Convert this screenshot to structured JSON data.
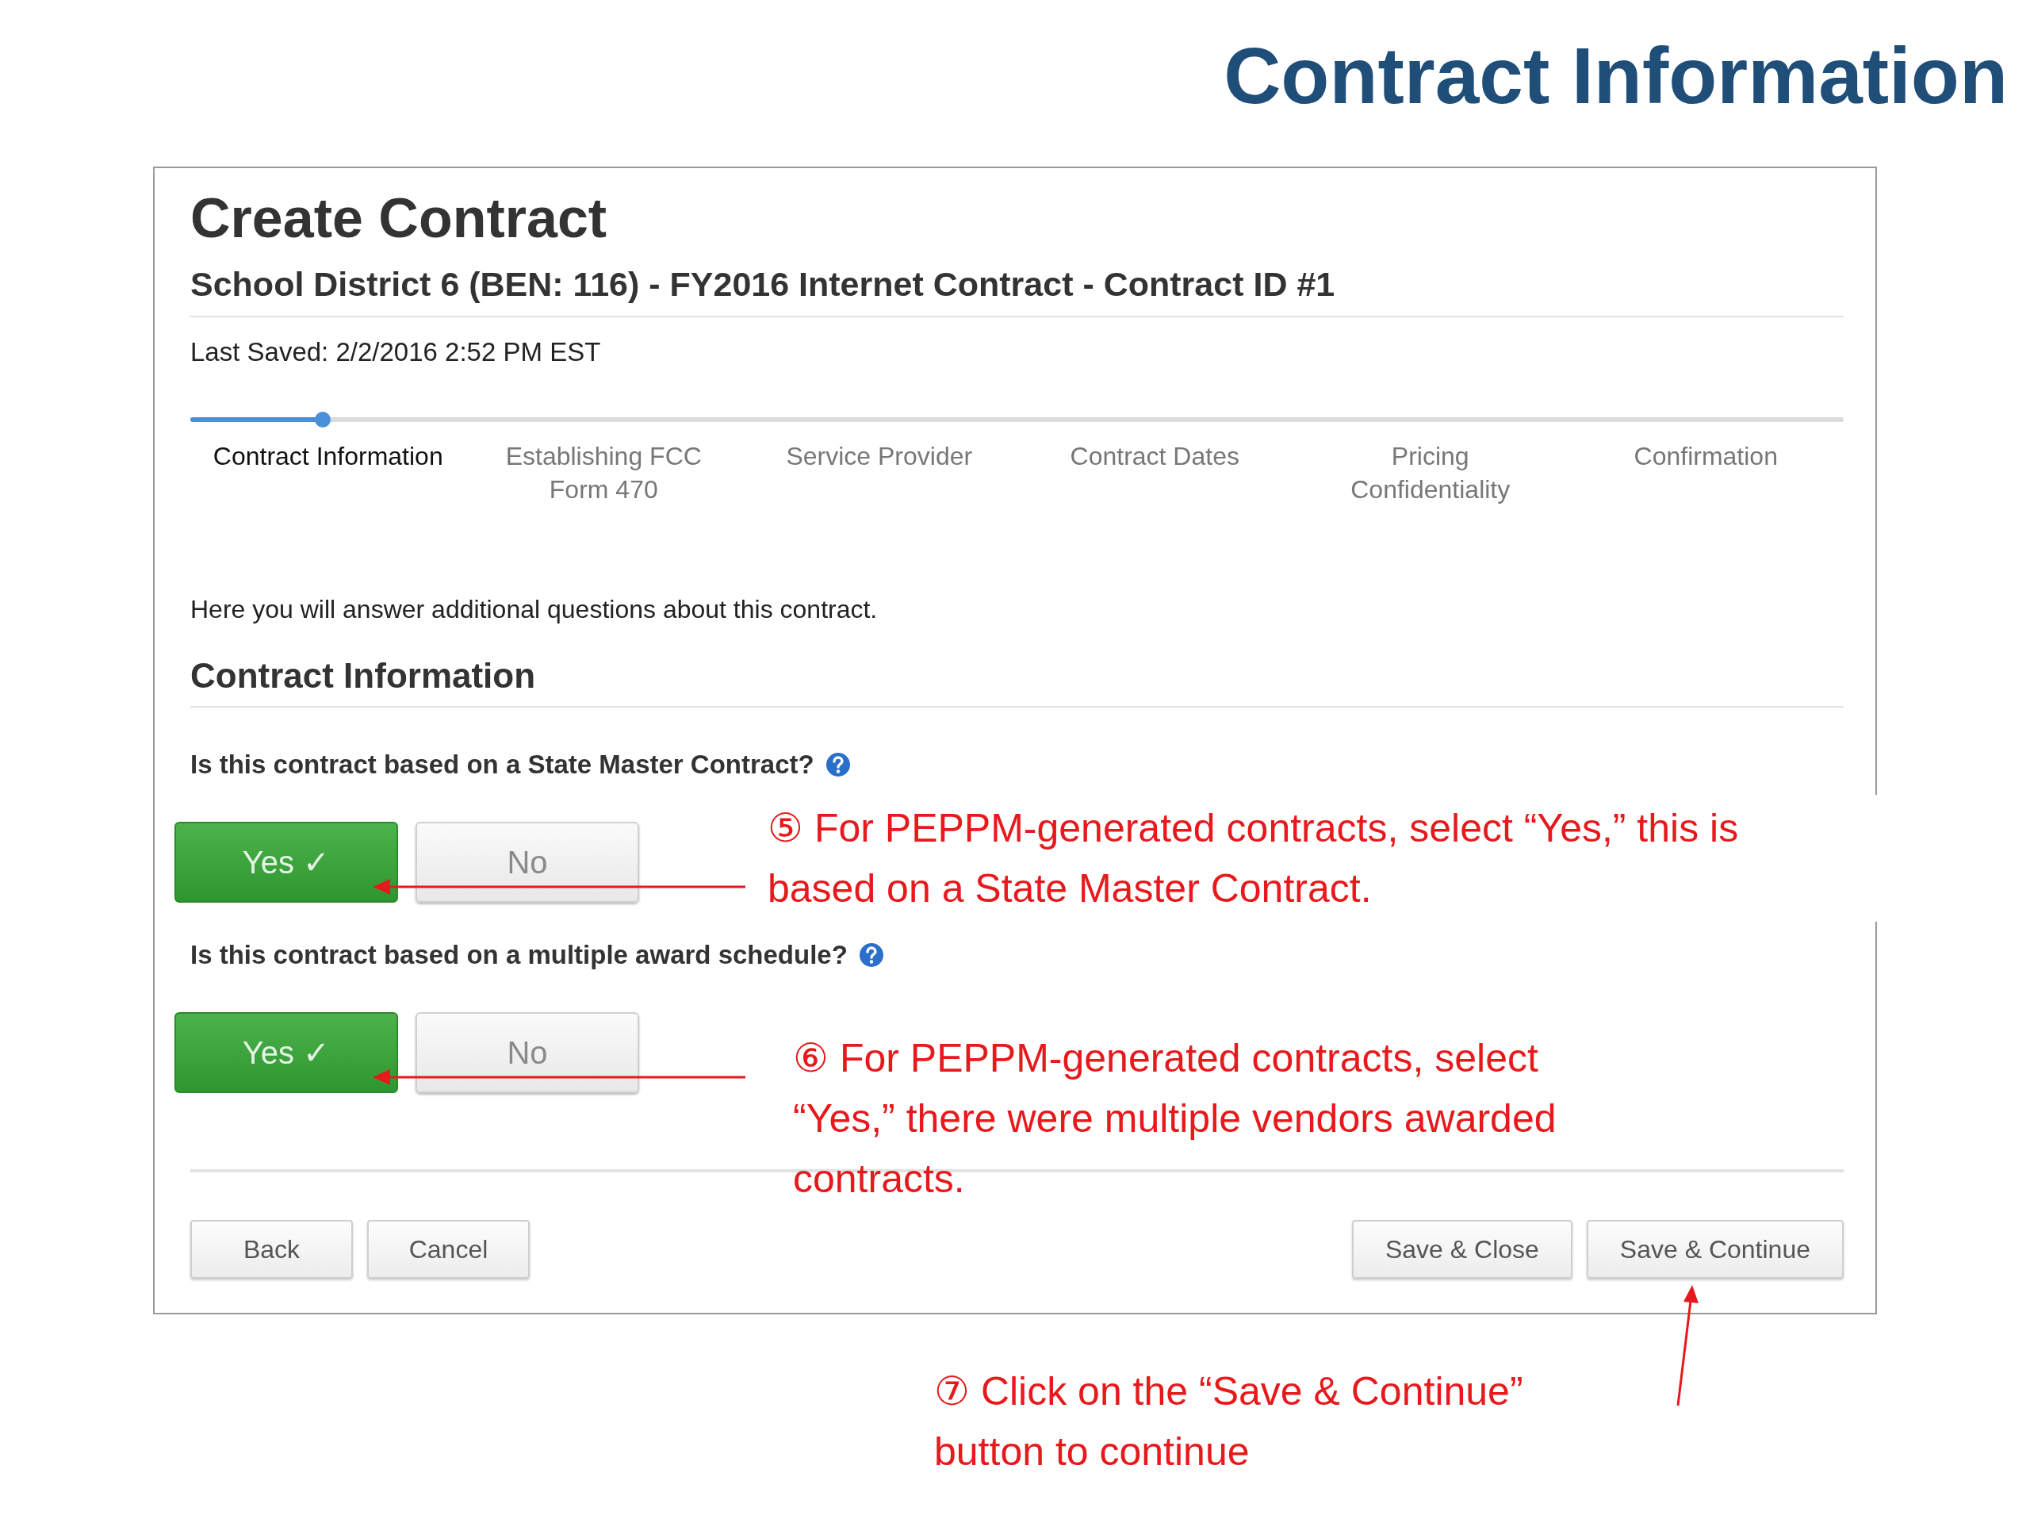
{
  "slide_title": "Contract Information",
  "form": {
    "title": "Create Contract",
    "subtitle": "School District 6 (BEN: 116) - FY2016 Internet Contract - Contract ID #1",
    "last_saved": "Last Saved: 2/2/2016 2:52 PM EST",
    "progress": {
      "level": 0.08
    },
    "steps": [
      {
        "label": "Contract Information",
        "selected": true
      },
      {
        "label": "Establishing FCC Form 470",
        "selected": false
      },
      {
        "label": "Service Provider",
        "selected": false
      },
      {
        "label": "Contract Dates",
        "selected": false
      },
      {
        "label": "Pricing Confidentiality",
        "selected": false
      },
      {
        "label": "Confirmation",
        "selected": false
      }
    ],
    "intro": "Here you will answer additional questions about this contract.",
    "section_title": "Contract Information",
    "questions": [
      {
        "label": "Is this contract based on a State Master Contract?",
        "options": [
          {
            "label": "Yes ✓",
            "selected": true
          },
          {
            "label": "No",
            "selected": false
          }
        ]
      },
      {
        "label": "Is this contract based on a multiple award schedule?",
        "options": [
          {
            "label": "Yes ✓",
            "selected": true
          },
          {
            "label": "No",
            "selected": false
          }
        ]
      }
    ],
    "buttons_left": [
      "Back",
      "Cancel"
    ],
    "buttons_right": [
      "Save & Close",
      "Save & Continue"
    ]
  },
  "annotations": [
    {
      "number": "⑤",
      "text": "For PEPPM-generated contracts, select “Yes,” this is based on a State Master Contract."
    },
    {
      "number": "⑥",
      "text": "For PEPPM-generated contracts, select “Yes,” there were multiple vendors awarded contracts."
    },
    {
      "number": "⑦",
      "text": "Click on the “Save & Continue” button to continue"
    }
  ]
}
